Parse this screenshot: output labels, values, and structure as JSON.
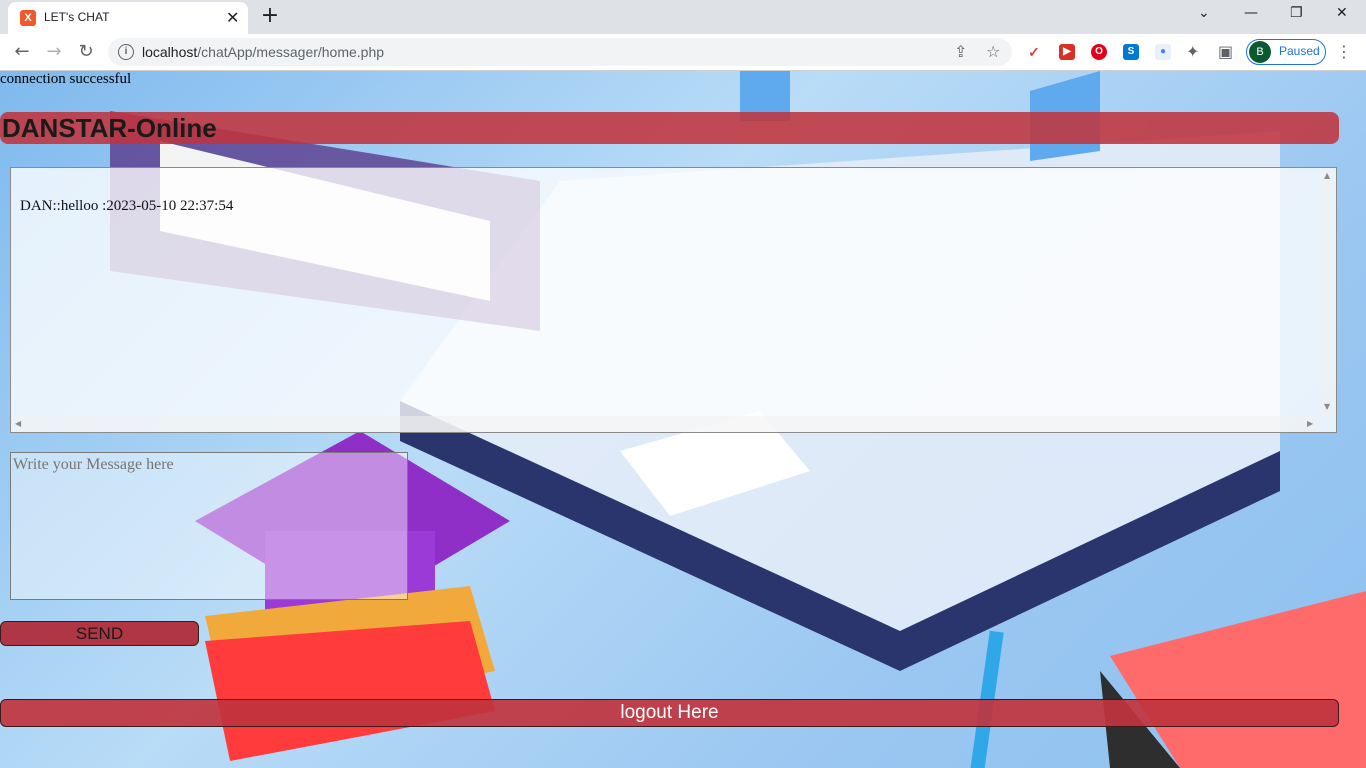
{
  "browser": {
    "tab_title": "LET's CHAT",
    "tab_favicon": "xampp-icon",
    "new_tab_symbol": "+",
    "url_host": "localhost",
    "url_path": "/chatApp/messager/home.php",
    "profile_initial": "B",
    "profile_status": "Paused",
    "extensions": [
      {
        "name": "todoist-extension-icon",
        "color": "#db4035",
        "glyph": "✓"
      },
      {
        "name": "video-extension-icon",
        "color": "#d93025",
        "glyph": "▶"
      },
      {
        "name": "opera-extension-icon",
        "color": "#e2001a",
        "glyph": "O"
      },
      {
        "name": "skype-extension-icon",
        "color": "#0078d4",
        "glyph": "S"
      },
      {
        "name": "blue-extension-icon",
        "color": "#4285f4",
        "glyph": "●"
      }
    ]
  },
  "page": {
    "status_message": "connection successful",
    "site_title": "DANSTAR-Online",
    "chat_messages": [
      {
        "text": "DAN::helloo :2023-05-10 22:37:54"
      }
    ],
    "message_placeholder": "Write your Message here",
    "send_label": "SEND",
    "logout_label": "logout Here"
  },
  "colors": {
    "accent_red": "#c0343e",
    "profile_blue": "#1a73e8"
  }
}
